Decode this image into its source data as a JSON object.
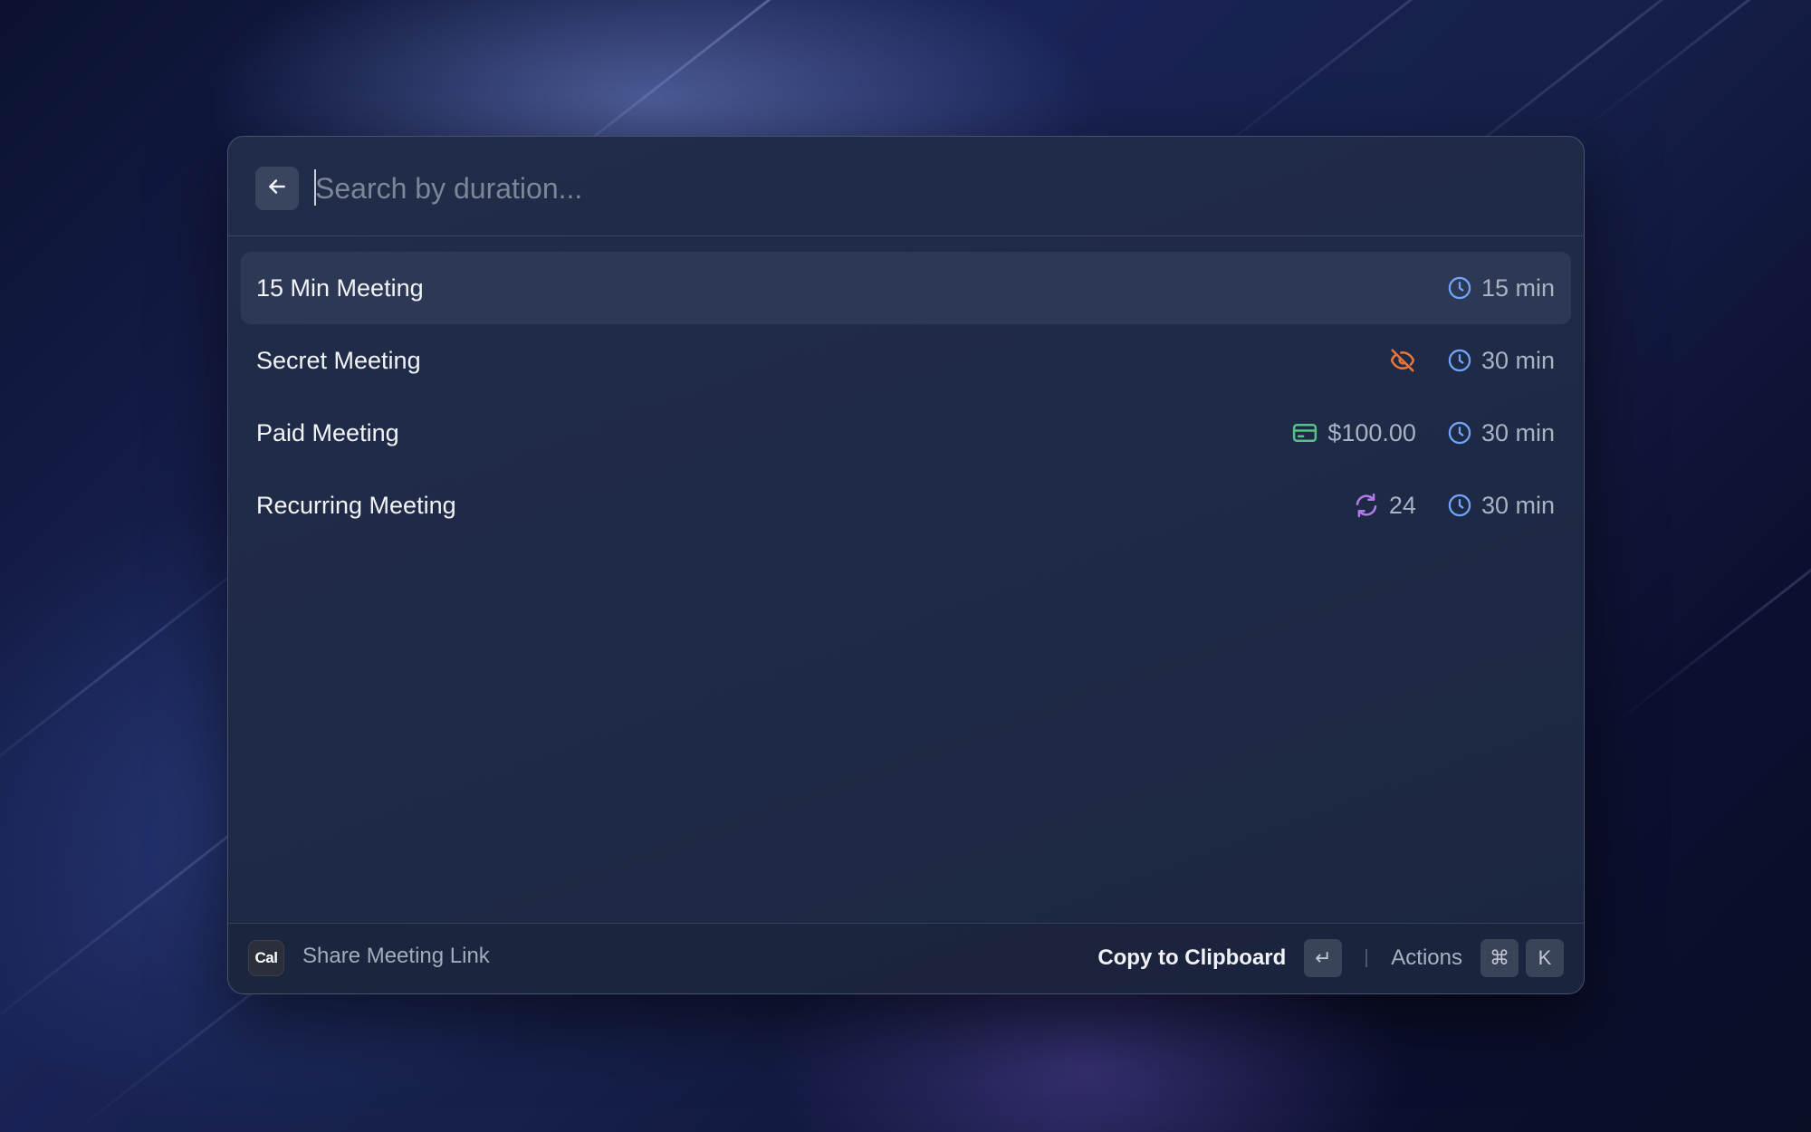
{
  "search": {
    "placeholder": "Search by duration...",
    "value": ""
  },
  "meetings": [
    {
      "title": "15 Min Meeting",
      "selected": true,
      "accessories": [
        {
          "icon": "clock-icon",
          "text": "15 min",
          "color": "#6fa3f5"
        }
      ]
    },
    {
      "title": "Secret Meeting",
      "selected": false,
      "accessories": [
        {
          "icon": "eye-off-icon",
          "text": "",
          "color": "#e8773a"
        },
        {
          "icon": "clock-icon",
          "text": "30 min",
          "color": "#6fa3f5"
        }
      ]
    },
    {
      "title": "Paid Meeting",
      "selected": false,
      "accessories": [
        {
          "icon": "credit-card-icon",
          "text": "$100.00",
          "color": "#56c28a"
        },
        {
          "icon": "clock-icon",
          "text": "30 min",
          "color": "#6fa3f5"
        }
      ]
    },
    {
      "title": "Recurring Meeting",
      "selected": false,
      "accessories": [
        {
          "icon": "repeat-icon",
          "text": "24",
          "color": "#b27ae8"
        },
        {
          "icon": "clock-icon",
          "text": "30 min",
          "color": "#6fa3f5"
        }
      ]
    }
  ],
  "footer": {
    "logo_text": "Cal",
    "title": "Share Meeting Link",
    "primary_action": "Copy to Clipboard",
    "primary_shortcut": "↵",
    "secondary_action": "Actions",
    "secondary_shortcut": [
      "⌘",
      "K"
    ]
  }
}
